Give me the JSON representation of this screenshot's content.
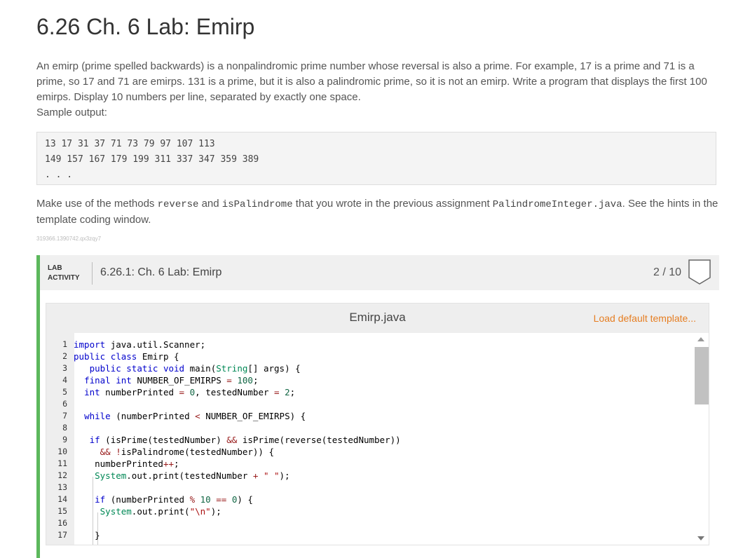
{
  "page": {
    "title": "6.26 Ch. 6 Lab: Emirp",
    "description": "An emirp (prime spelled backwards) is a nonpalindromic prime number whose reversal is also a prime. For example, 17 is a prime and 71 is a prime, so 17 and 71 are emirps. 131 is a prime, but it is also a palindromic prime, so it is not an emirp. Write a program that displays the first 100 emirps. Display 10 numbers per line, separated by exactly one space.",
    "sample_label": "Sample output:",
    "sample_lines": [
      "13 17 31 37 71 73 79 97 107 113",
      "149 157 167 179 199 311 337 347 359 389",
      ". . ."
    ],
    "hint_part1": "Make use of the methods ",
    "hint_code1": "reverse",
    "hint_part2": " and ",
    "hint_code2": "isPalindrome",
    "hint_part3": " that you wrote in the previous assignment ",
    "hint_code3": "PalindromeInteger.java",
    "hint_part4": ". See the hints in the template coding window.",
    "id_code": "319366.1390742.qx3zqy7"
  },
  "lab": {
    "tag_line1": "LAB",
    "tag_line2": "ACTIVITY",
    "title": "6.26.1: Ch. 6 Lab: Emirp",
    "score": "2 / 10",
    "accent_color": "#5cb85c"
  },
  "editor": {
    "file_name": "Emirp.java",
    "load_template_label": "Load default template...",
    "link_color": "#e67e22",
    "lines": [
      {
        "n": "1",
        "html": "<span class='kw'>import</span> <span class='plain'>java.util.Scanner;</span>"
      },
      {
        "n": "2",
        "html": "<span class='kw'>public</span> <span class='kw'>class</span> <span class='plain'>Emirp {</span>"
      },
      {
        "n": "3",
        "html": "   <span class='kw'>public</span> <span class='kw'>static</span> <span class='kw'>void</span> <span class='plain'>main(</span><span class='ty'>String</span><span class='plain'>[] args) {</span>"
      },
      {
        "n": "4",
        "html": "  <span class='kw'>final</span> <span class='kw'>int</span> <span class='plain'>NUMBER_OF_EMIRPS</span> <span class='op'>=</span> <span class='num'>100</span><span class='plain'>;</span>"
      },
      {
        "n": "5",
        "html": "  <span class='kw'>int</span> <span class='plain'>numberPrinted</span> <span class='op'>=</span> <span class='num'>0</span><span class='plain'>, testedNumber</span> <span class='op'>=</span> <span class='num'>2</span><span class='plain'>;</span>"
      },
      {
        "n": "6",
        "html": ""
      },
      {
        "n": "7",
        "html": "  <span class='kw'>while</span> <span class='plain'>(numberPrinted</span> <span class='op'>&lt;</span> <span class='plain'>NUMBER_OF_EMIRPS) {</span>"
      },
      {
        "n": "8",
        "html": ""
      },
      {
        "n": "9",
        "html": "   <span class='kw'>if</span> <span class='plain'>(isPrime(testedNumber)</span> <span class='op'>&amp;&amp;</span> <span class='plain'>isPrime(reverse(testedNumber))</span>"
      },
      {
        "n": "10",
        "html": "     <span class='op'>&amp;&amp;</span> <span class='op'>!</span><span class='plain'>isPalindrome(testedNumber)) {</span>"
      },
      {
        "n": "11",
        "html": "    <span class='plain'>numberPrinted</span><span class='op'>++</span><span class='plain'>;</span>"
      },
      {
        "n": "12",
        "html": "    <span class='ty'>System</span><span class='plain'>.out.print(testedNumber</span> <span class='op'>+</span> <span class='str'>\" \"</span><span class='plain'>);</span>"
      },
      {
        "n": "13",
        "html": ""
      },
      {
        "n": "14",
        "html": "    <span class='kw'>if</span> <span class='plain'>(numberPrinted</span> <span class='op'>%</span> <span class='num'>10</span> <span class='op'>==</span> <span class='num'>0</span><span class='plain'>) {</span>"
      },
      {
        "n": "15",
        "html": "     <span class='ty'>System</span><span class='plain'>.out.print(</span><span class='str'>\"\\n\"</span><span class='plain'>);</span>"
      },
      {
        "n": "16",
        "html": ""
      },
      {
        "n": "17",
        "html": "    <span class='plain'>}</span>"
      }
    ]
  }
}
